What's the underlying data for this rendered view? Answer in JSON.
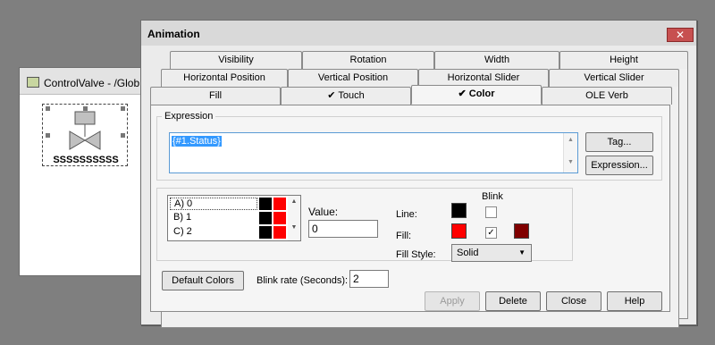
{
  "background_window": {
    "title": "ControlValve - /Glob",
    "symbol_text": "SSSSSSSSSS"
  },
  "dialog": {
    "title": "Animation",
    "close_glyph": "✕"
  },
  "tabs": {
    "row1": [
      "Visibility",
      "Rotation",
      "Width",
      "Height"
    ],
    "row2": [
      "Horizontal Position",
      "Vertical Position",
      "Horizontal Slider",
      "Vertical Slider"
    ],
    "row3": [
      "Fill",
      "✔ Touch",
      "✔ Color",
      "OLE Verb"
    ]
  },
  "expression": {
    "group_label": "Expression",
    "value": "{#1.Status}",
    "tag_button": "Tag...",
    "expression_button": "Expression..."
  },
  "state_list": {
    "items": [
      "A) 0",
      "B) 1",
      "C) 2"
    ]
  },
  "value": {
    "label": "Value:",
    "input": "0"
  },
  "colors": {
    "blink_label": "Blink",
    "line_label": "Line:",
    "fill_label": "Fill:",
    "fill_style_label": "Fill Style:",
    "fill_style_value": "Solid",
    "line_color": "#000000",
    "fill_color": "#ff0000",
    "blink_color": "#800000",
    "check_mark": "✓"
  },
  "bottom": {
    "default_colors": "Default Colors",
    "blink_rate_label": "Blink rate (Seconds):",
    "blink_rate_value": "2"
  },
  "buttons": {
    "apply": "Apply",
    "delete": "Delete",
    "close": "Close",
    "help": "Help"
  }
}
